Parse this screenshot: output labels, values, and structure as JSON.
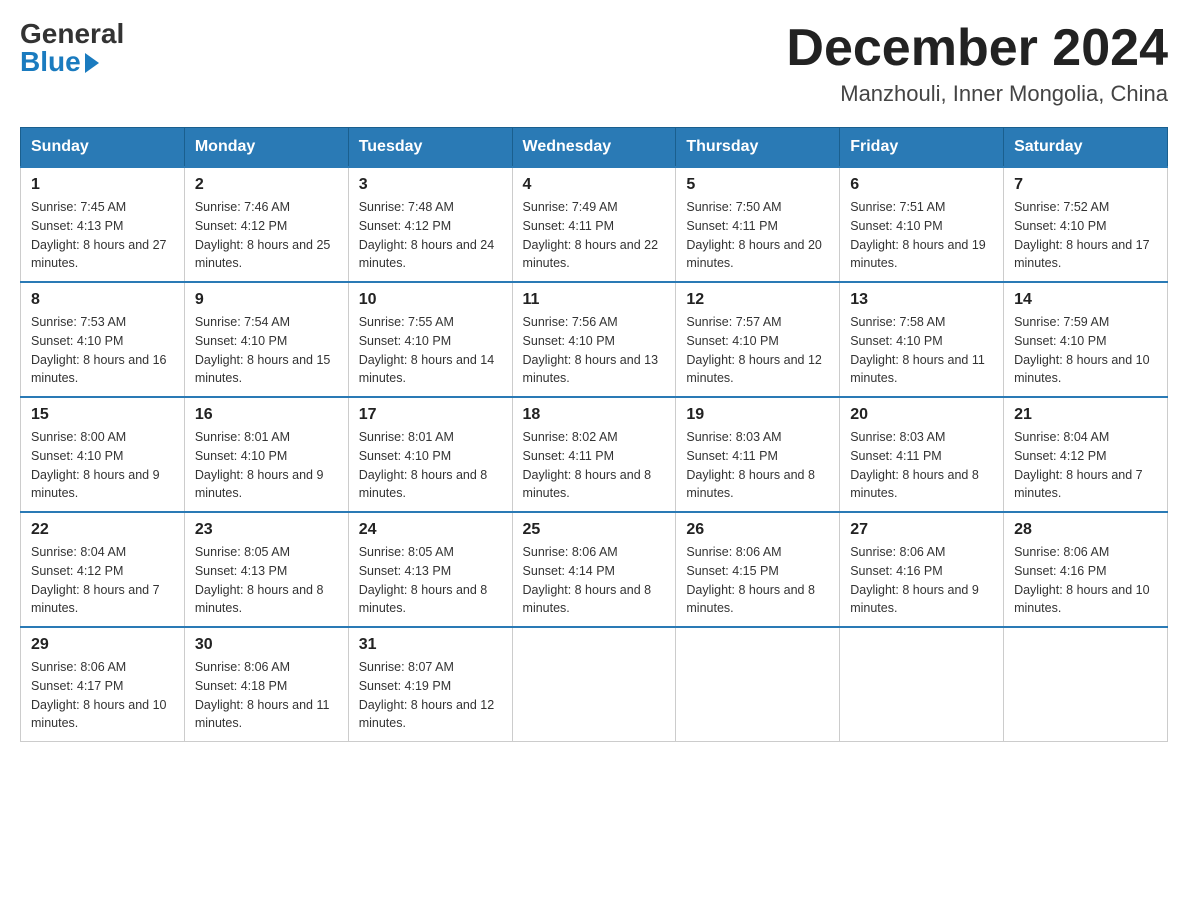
{
  "header": {
    "logo_general": "General",
    "logo_blue": "Blue",
    "month_title": "December 2024",
    "location": "Manzhouli, Inner Mongolia, China"
  },
  "days_of_week": [
    "Sunday",
    "Monday",
    "Tuesday",
    "Wednesday",
    "Thursday",
    "Friday",
    "Saturday"
  ],
  "weeks": [
    [
      {
        "day": "1",
        "sunrise": "7:45 AM",
        "sunset": "4:13 PM",
        "daylight": "8 hours and 27 minutes."
      },
      {
        "day": "2",
        "sunrise": "7:46 AM",
        "sunset": "4:12 PM",
        "daylight": "8 hours and 25 minutes."
      },
      {
        "day": "3",
        "sunrise": "7:48 AM",
        "sunset": "4:12 PM",
        "daylight": "8 hours and 24 minutes."
      },
      {
        "day": "4",
        "sunrise": "7:49 AM",
        "sunset": "4:11 PM",
        "daylight": "8 hours and 22 minutes."
      },
      {
        "day": "5",
        "sunrise": "7:50 AM",
        "sunset": "4:11 PM",
        "daylight": "8 hours and 20 minutes."
      },
      {
        "day": "6",
        "sunrise": "7:51 AM",
        "sunset": "4:10 PM",
        "daylight": "8 hours and 19 minutes."
      },
      {
        "day": "7",
        "sunrise": "7:52 AM",
        "sunset": "4:10 PM",
        "daylight": "8 hours and 17 minutes."
      }
    ],
    [
      {
        "day": "8",
        "sunrise": "7:53 AM",
        "sunset": "4:10 PM",
        "daylight": "8 hours and 16 minutes."
      },
      {
        "day": "9",
        "sunrise": "7:54 AM",
        "sunset": "4:10 PM",
        "daylight": "8 hours and 15 minutes."
      },
      {
        "day": "10",
        "sunrise": "7:55 AM",
        "sunset": "4:10 PM",
        "daylight": "8 hours and 14 minutes."
      },
      {
        "day": "11",
        "sunrise": "7:56 AM",
        "sunset": "4:10 PM",
        "daylight": "8 hours and 13 minutes."
      },
      {
        "day": "12",
        "sunrise": "7:57 AM",
        "sunset": "4:10 PM",
        "daylight": "8 hours and 12 minutes."
      },
      {
        "day": "13",
        "sunrise": "7:58 AM",
        "sunset": "4:10 PM",
        "daylight": "8 hours and 11 minutes."
      },
      {
        "day": "14",
        "sunrise": "7:59 AM",
        "sunset": "4:10 PM",
        "daylight": "8 hours and 10 minutes."
      }
    ],
    [
      {
        "day": "15",
        "sunrise": "8:00 AM",
        "sunset": "4:10 PM",
        "daylight": "8 hours and 9 minutes."
      },
      {
        "day": "16",
        "sunrise": "8:01 AM",
        "sunset": "4:10 PM",
        "daylight": "8 hours and 9 minutes."
      },
      {
        "day": "17",
        "sunrise": "8:01 AM",
        "sunset": "4:10 PM",
        "daylight": "8 hours and 8 minutes."
      },
      {
        "day": "18",
        "sunrise": "8:02 AM",
        "sunset": "4:11 PM",
        "daylight": "8 hours and 8 minutes."
      },
      {
        "day": "19",
        "sunrise": "8:03 AM",
        "sunset": "4:11 PM",
        "daylight": "8 hours and 8 minutes."
      },
      {
        "day": "20",
        "sunrise": "8:03 AM",
        "sunset": "4:11 PM",
        "daylight": "8 hours and 8 minutes."
      },
      {
        "day": "21",
        "sunrise": "8:04 AM",
        "sunset": "4:12 PM",
        "daylight": "8 hours and 7 minutes."
      }
    ],
    [
      {
        "day": "22",
        "sunrise": "8:04 AM",
        "sunset": "4:12 PM",
        "daylight": "8 hours and 7 minutes."
      },
      {
        "day": "23",
        "sunrise": "8:05 AM",
        "sunset": "4:13 PM",
        "daylight": "8 hours and 8 minutes."
      },
      {
        "day": "24",
        "sunrise": "8:05 AM",
        "sunset": "4:13 PM",
        "daylight": "8 hours and 8 minutes."
      },
      {
        "day": "25",
        "sunrise": "8:06 AM",
        "sunset": "4:14 PM",
        "daylight": "8 hours and 8 minutes."
      },
      {
        "day": "26",
        "sunrise": "8:06 AM",
        "sunset": "4:15 PM",
        "daylight": "8 hours and 8 minutes."
      },
      {
        "day": "27",
        "sunrise": "8:06 AM",
        "sunset": "4:16 PM",
        "daylight": "8 hours and 9 minutes."
      },
      {
        "day": "28",
        "sunrise": "8:06 AM",
        "sunset": "4:16 PM",
        "daylight": "8 hours and 10 minutes."
      }
    ],
    [
      {
        "day": "29",
        "sunrise": "8:06 AM",
        "sunset": "4:17 PM",
        "daylight": "8 hours and 10 minutes."
      },
      {
        "day": "30",
        "sunrise": "8:06 AM",
        "sunset": "4:18 PM",
        "daylight": "8 hours and 11 minutes."
      },
      {
        "day": "31",
        "sunrise": "8:07 AM",
        "sunset": "4:19 PM",
        "daylight": "8 hours and 12 minutes."
      },
      null,
      null,
      null,
      null
    ]
  ]
}
